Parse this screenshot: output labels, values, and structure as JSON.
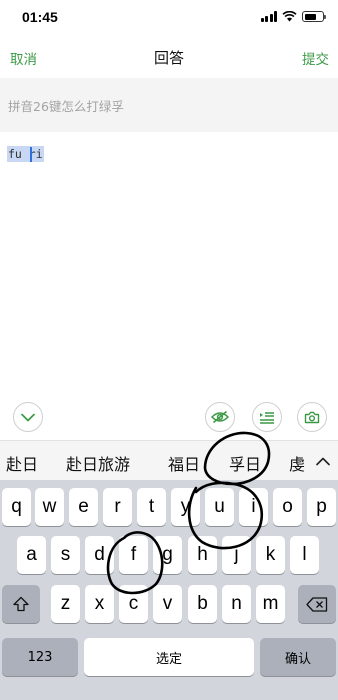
{
  "status_bar": {
    "time": "01:45",
    "icons": [
      "signal-icon",
      "wifi-icon",
      "battery-icon"
    ]
  },
  "nav": {
    "cancel_label": "取消",
    "title": "回答",
    "submit_label": "提交"
  },
  "question": {
    "text": "拼音26键怎么打绿孚"
  },
  "answer": {
    "text": "fu ri"
  },
  "toolbar": {
    "icons": [
      "chevron-down-icon",
      "eye-icon",
      "list-icon",
      "camera-icon"
    ]
  },
  "candidates": {
    "items": [
      "赴日",
      "赴日旅游",
      "福日",
      "孚日",
      "虔"
    ]
  },
  "keyboard": {
    "row1": [
      "q",
      "w",
      "e",
      "r",
      "t",
      "y",
      "u",
      "i",
      "o",
      "p"
    ],
    "row2": [
      "a",
      "s",
      "d",
      "f",
      "g",
      "h",
      "j",
      "k",
      "l"
    ],
    "row3": [
      "z",
      "x",
      "c",
      "v",
      "b",
      "n",
      "m"
    ],
    "numbers_label": "123",
    "space_label": "选定",
    "confirm_label": "确认"
  },
  "colors": {
    "accent": "#3c9a45",
    "selection": "#c8d7f4",
    "keyboard_bg": "#d2d5db"
  }
}
